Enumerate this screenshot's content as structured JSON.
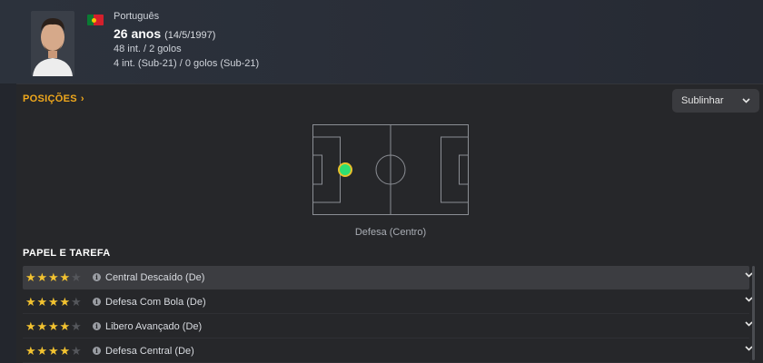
{
  "player": {
    "nationality": "Português",
    "age": "26 anos",
    "dob": "(14/5/1997)",
    "caps": "48 int. / 2 golos",
    "caps_u21": "4 int. (Sub-21) / 0 golos (Sub-21)",
    "flag_colors": {
      "green": "#0a7a33",
      "red": "#d4202c",
      "yellow": "#f5c400"
    }
  },
  "positions": {
    "title": "POSIÇÕES",
    "chevron": "›",
    "highlight_button": "Sublinhar",
    "pitch_label": "Defesa (Centro)",
    "marker_color": "#2ee072",
    "marker_ring": "#e8c12c"
  },
  "roles": {
    "title": "PAPEL E TAREFA",
    "items": [
      {
        "name": "Central Descaído (De)",
        "stars": 4
      },
      {
        "name": "Defesa Com Bola (De)",
        "stars": 4
      },
      {
        "name": "Libero Avançado (De)",
        "stars": 4
      },
      {
        "name": "Defesa Central (De)",
        "stars": 4
      }
    ]
  },
  "colors": {
    "accent": "#f0a81c",
    "star": "#f2c230"
  }
}
